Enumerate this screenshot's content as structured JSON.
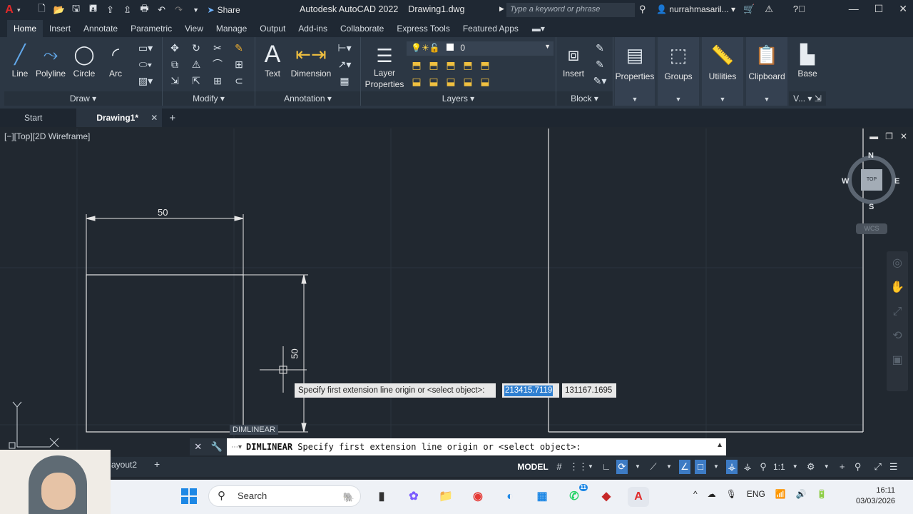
{
  "title_bar": {
    "app_name": "Autodesk AutoCAD 2022",
    "file_name": "Drawing1.dwg",
    "share_label": "Share",
    "search_placeholder": "Type a keyword or phrase",
    "user_name": "nurrahmasaril..."
  },
  "ribbon_tabs": [
    "Home",
    "Insert",
    "Annotate",
    "Parametric",
    "View",
    "Manage",
    "Output",
    "Add-ins",
    "Collaborate",
    "Express Tools",
    "Featured Apps"
  ],
  "ribbon": {
    "draw": {
      "title": "Draw",
      "line": "Line",
      "polyline": "Polyline",
      "circle": "Circle",
      "arc": "Arc"
    },
    "modify": {
      "title": "Modify"
    },
    "annotation": {
      "title": "Annotation",
      "text": "Text",
      "dimension": "Dimension"
    },
    "layers": {
      "title": "Layers",
      "layer_properties_line1": "Layer",
      "layer_properties_line2": "Properties",
      "current_layer": "0"
    },
    "block": {
      "title": "Block",
      "insert": "Insert"
    },
    "properties": "Properties",
    "groups": "Groups",
    "utilities": "Utilities",
    "clipboard": "Clipboard",
    "base": "Base",
    "view_short": "V..."
  },
  "file_tabs": {
    "start": "Start",
    "drawing": "Drawing1*"
  },
  "viewport": {
    "label": "[−][Top][2D Wireframe]",
    "viewcube": {
      "north": "N",
      "south": "S",
      "east": "E",
      "west": "W",
      "face": "TOP"
    },
    "wcs": "WCS"
  },
  "drawing": {
    "dim_horizontal": "50",
    "dim_vertical": "50"
  },
  "dynamic_input": {
    "prompt": "Specify first extension line origin or <select object>:",
    "x_value": "213415.7119",
    "y_value": "131167.1695",
    "command_label": "DIMLINEAR"
  },
  "command_line": {
    "command": "DIMLINEAR",
    "prompt": "Specify first extension line origin or <select object>:"
  },
  "status_bar": {
    "layout_tab": "ayout2",
    "model": "MODEL",
    "scale": "1:1"
  },
  "taskbar": {
    "search_label": "Search",
    "whatsapp_badge": "11",
    "language": "ENG",
    "time": "16:11",
    "date": "03/03/2026"
  },
  "colors": {
    "accent": "#3d7bc4",
    "canvas": "#212830",
    "autocad_red": "#e02a2a"
  }
}
